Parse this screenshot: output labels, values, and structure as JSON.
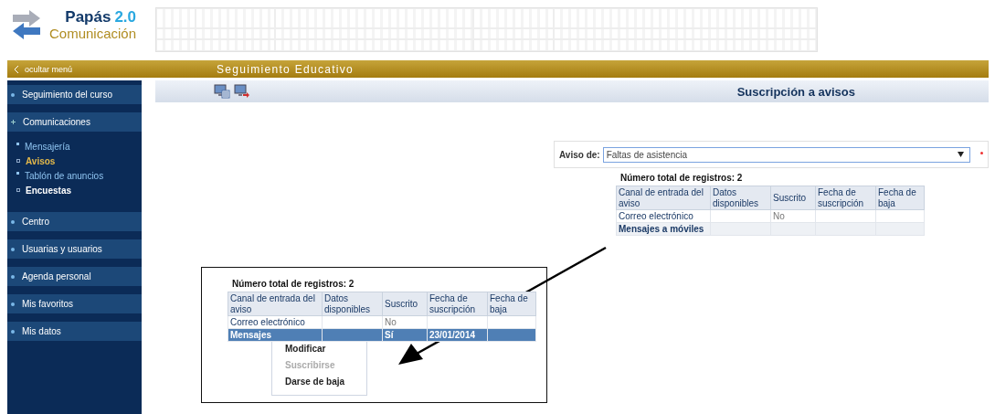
{
  "logo": {
    "name": "Papás",
    "version": "2.0",
    "subtitle": "Comunicación"
  },
  "menu_bar": {
    "hide_menu": "ocultar menú",
    "title": "Seguimiento Educativo"
  },
  "sidebar": {
    "items": [
      {
        "label": "Seguimiento del curso",
        "expanded": false
      },
      {
        "label": "Comunicaciones",
        "expanded": true,
        "children": [
          {
            "label": "Mensajería",
            "kind": "section",
            "selected": false
          },
          {
            "label": "Avisos",
            "kind": "page",
            "selected": true
          },
          {
            "label": "Tablón de anuncios",
            "kind": "section",
            "selected": false
          },
          {
            "label": "Encuestas",
            "kind": "page",
            "selected": false
          }
        ]
      },
      {
        "label": "Centro",
        "expanded": false
      },
      {
        "label": "Usuarias y usuarios",
        "expanded": false
      },
      {
        "label": "Agenda personal",
        "expanded": false
      },
      {
        "label": "Mis favoritos",
        "expanded": false
      },
      {
        "label": "Mis datos",
        "expanded": false
      }
    ]
  },
  "page_title": "Suscripción a avisos",
  "form": {
    "label": "Aviso de:",
    "value": "Faltas de asistencia",
    "required": true
  },
  "table": {
    "count_label": "Número total de registros: 2",
    "columns": [
      "Canal de entrada del aviso",
      "Datos disponibles",
      "Suscrito",
      "Fecha de suscripción",
      "Fecha de baja"
    ],
    "rows": [
      {
        "canal": "Correo electrónico",
        "suscrito": "No",
        "selected": false
      },
      {
        "canal": "Mensajes a móviles",
        "selected": false
      }
    ]
  },
  "callout": {
    "count_label": "Número total de registros: 2",
    "columns": [
      "Canal de entrada del aviso",
      "Datos disponibles",
      "Suscrito",
      "Fecha de suscripción",
      "Fecha de baja"
    ],
    "rows": [
      {
        "canal": "Correo electrónico",
        "suscrito": "No",
        "selected": false
      },
      {
        "canal": "Mensajes",
        "suscrito": "Sí",
        "fecha_suscripcion": "23/01/2014",
        "selected": true
      }
    ],
    "context_menu": [
      {
        "label": "Modificar",
        "disabled": false
      },
      {
        "label": "Suscribirse",
        "disabled": true
      },
      {
        "label": "Darse de baja",
        "disabled": false
      }
    ]
  }
}
